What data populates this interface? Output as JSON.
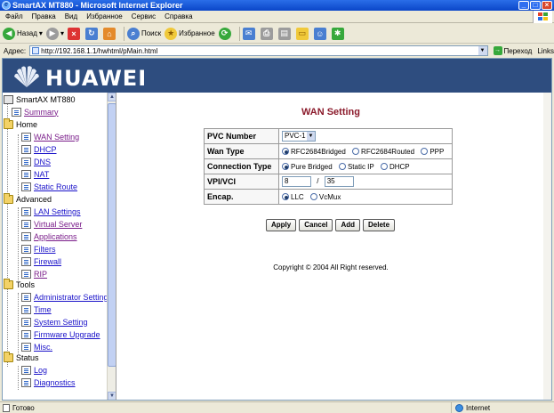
{
  "window": {
    "title": "SmartAX MT880 - Microsoft Internet Explorer"
  },
  "menu": [
    "Файл",
    "Правка",
    "Вид",
    "Избранное",
    "Сервис",
    "Справка"
  ],
  "toolbar": {
    "back_label": "Назад",
    "search_label": "Поиск",
    "favorites_label": "Избранное"
  },
  "address": {
    "label": "Адрес:",
    "url": "http://192.168.1.1/hwhtml/pMain.html",
    "go_label": "Переход",
    "links_label": "Links"
  },
  "brand": {
    "name": "HUAWEI"
  },
  "tree": {
    "root": "SmartAX MT880",
    "summary": "Summary",
    "groups": [
      {
        "label": "Home",
        "items": [
          "WAN Setting",
          "DHCP",
          "DNS",
          "NAT",
          "Static Route"
        ]
      },
      {
        "label": "Advanced",
        "items": [
          "LAN Settings",
          "Virtual Server",
          "Applications",
          "Filters",
          "Firewall",
          "RIP"
        ]
      },
      {
        "label": "Tools",
        "items": [
          "Administrator Setting",
          "Time",
          "System Setting",
          "Firmware Upgrade",
          "Misc."
        ]
      },
      {
        "label": "Status",
        "items": [
          "Log",
          "Diagnostics"
        ]
      }
    ]
  },
  "wan": {
    "heading": "WAN Setting",
    "pvc_label": "PVC Number",
    "pvc_value": "PVC-1",
    "wan_type_label": "Wan Type",
    "wan_type_options": [
      "RFC2684Bridged",
      "RFC2684Routed",
      "PPP"
    ],
    "wan_type_selected": 0,
    "conn_type_label": "Connection Type",
    "conn_type_options": [
      "Pure Bridged",
      "Static IP",
      "DHCP"
    ],
    "conn_type_selected": 0,
    "vpivci_label": "VPI/VCI",
    "vpi": "8",
    "vci_sep": "/",
    "vci": "35",
    "encap_label": "Encap.",
    "encap_options": [
      "LLC",
      "VcMux"
    ],
    "encap_selected": 0,
    "buttons": [
      "Apply",
      "Cancel",
      "Add",
      "Delete"
    ],
    "copyright": "Copyright © 2004 All Right reserved."
  },
  "status": {
    "done": "Готово",
    "zone": "Internet"
  }
}
